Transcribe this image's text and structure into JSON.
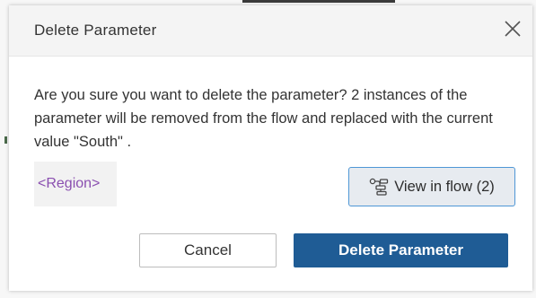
{
  "dialog": {
    "title": "Delete Parameter",
    "close_icon": "close-icon",
    "message": "Are you sure you want to delete the parameter? 2 instances of the parameter will be removed from the flow and replaced with the current value \"South\" .",
    "parameter_name": "<Region>",
    "view_in_flow": {
      "icon": "flow-icon",
      "label": "View in flow (2)"
    },
    "buttons": {
      "cancel_label": "Cancel",
      "delete_label": "Delete Parameter"
    }
  },
  "colors": {
    "primary": "#1f5c95",
    "parameter_text": "#8a4fb0",
    "focus_border": "#4f97d6"
  }
}
